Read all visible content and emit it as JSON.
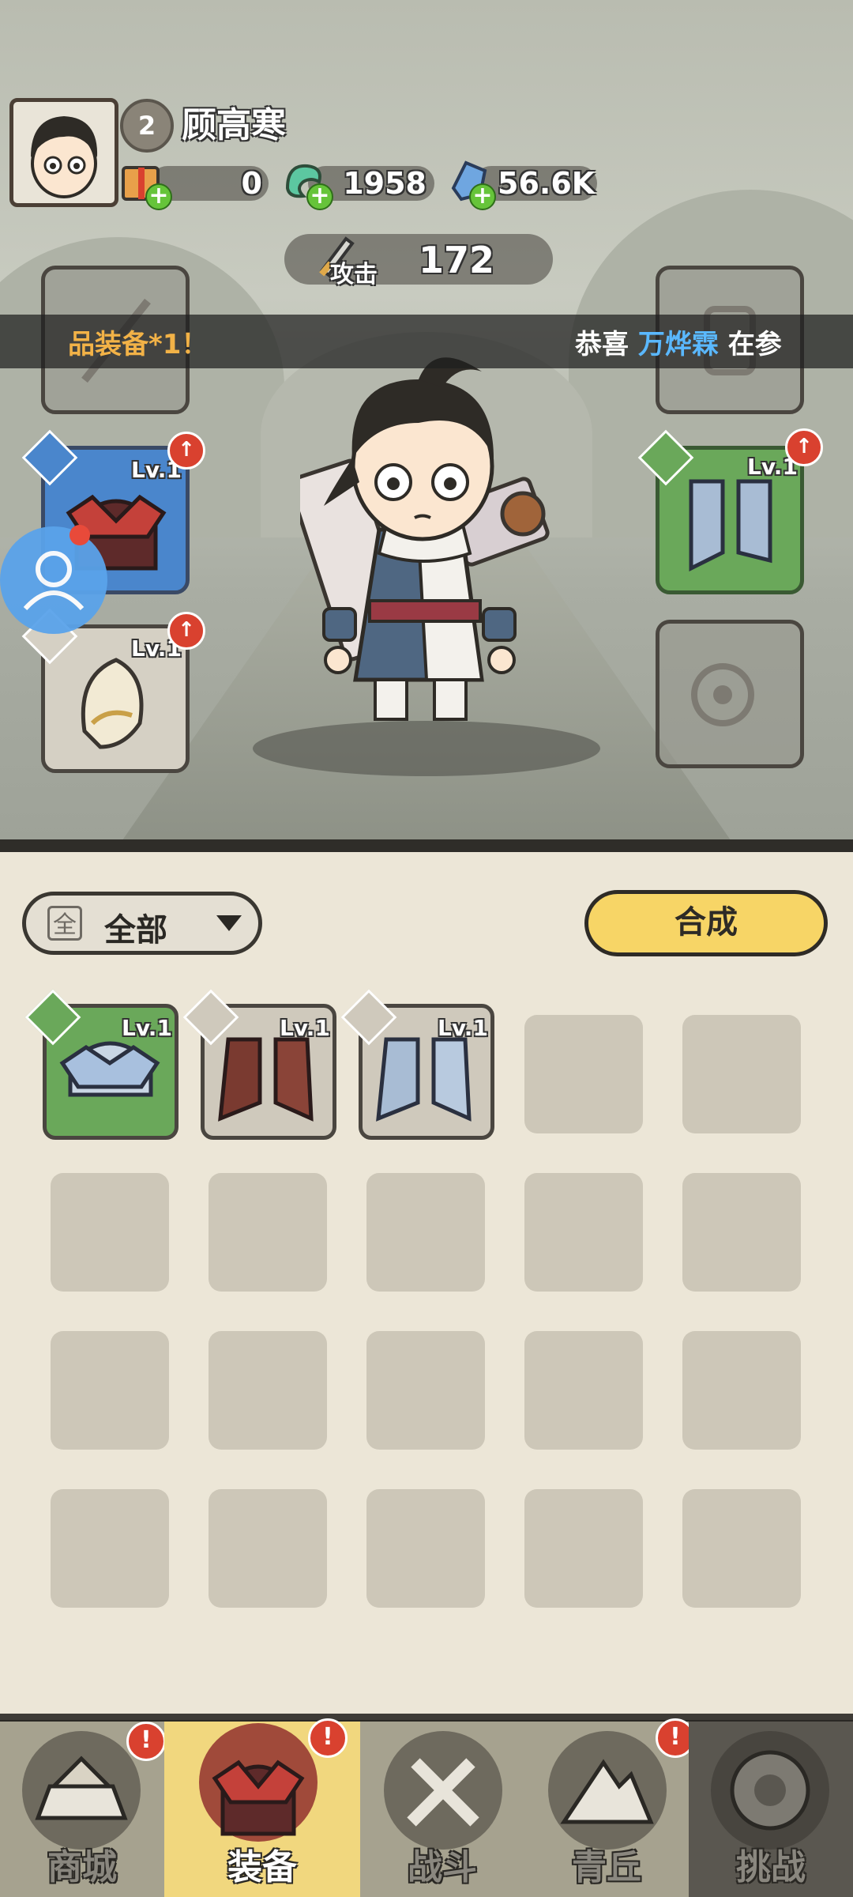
{
  "player": {
    "level": "2",
    "name": "顾高寒"
  },
  "currencies": [
    {
      "icon": "gift-box-icon",
      "value": "0"
    },
    {
      "icon": "jade-dragon-icon",
      "value": "1958"
    },
    {
      "icon": "crystal-icon",
      "value": "56.6K"
    }
  ],
  "attack": {
    "label": "攻击",
    "value": "172"
  },
  "announcement": {
    "left_text": "品装备*1！",
    "right_prefix": "恭喜",
    "right_name": "万烨霖",
    "right_suffix": "在参"
  },
  "equipped": {
    "left": [
      {
        "slot": "weapon",
        "state": "empty"
      },
      {
        "slot": "helmet",
        "level": "Lv.1",
        "color": "blue"
      },
      {
        "slot": "accessory",
        "level": "Lv.1",
        "color": "grey"
      }
    ],
    "right": [
      {
        "slot": "armor",
        "state": "empty"
      },
      {
        "slot": "boots",
        "level": "Lv.1",
        "color": "green"
      },
      {
        "slot": "ring",
        "state": "empty"
      }
    ]
  },
  "inventory": {
    "filter_icon": "全",
    "filter_label": "全部",
    "merge_label": "合成",
    "items": [
      {
        "name": "crystal-helmet",
        "level": "Lv.1",
        "color": "green"
      },
      {
        "name": "red-boots",
        "level": "Lv.1",
        "color": "grey"
      },
      {
        "name": "frost-boots",
        "level": "Lv.1",
        "color": "grey"
      }
    ],
    "empty_slots": 17
  },
  "nav": {
    "tabs": [
      {
        "label": "商城",
        "icon": "shop-icon",
        "badge": "!"
      },
      {
        "label": "装备",
        "icon": "equipment-icon",
        "badge": "!",
        "active": true
      },
      {
        "label": "战斗",
        "icon": "crossed-swords-icon"
      },
      {
        "label": "青丘",
        "icon": "mountain-icon",
        "badge": "!"
      },
      {
        "label": "挑战",
        "icon": "challenge-icon"
      }
    ]
  },
  "colors": {
    "accent_yellow": "#f7d566",
    "rarity_blue": "#4a86cc",
    "rarity_green": "#6aa85a",
    "highlight_blue": "#5ab8ff",
    "alert_red": "#d9412f"
  }
}
